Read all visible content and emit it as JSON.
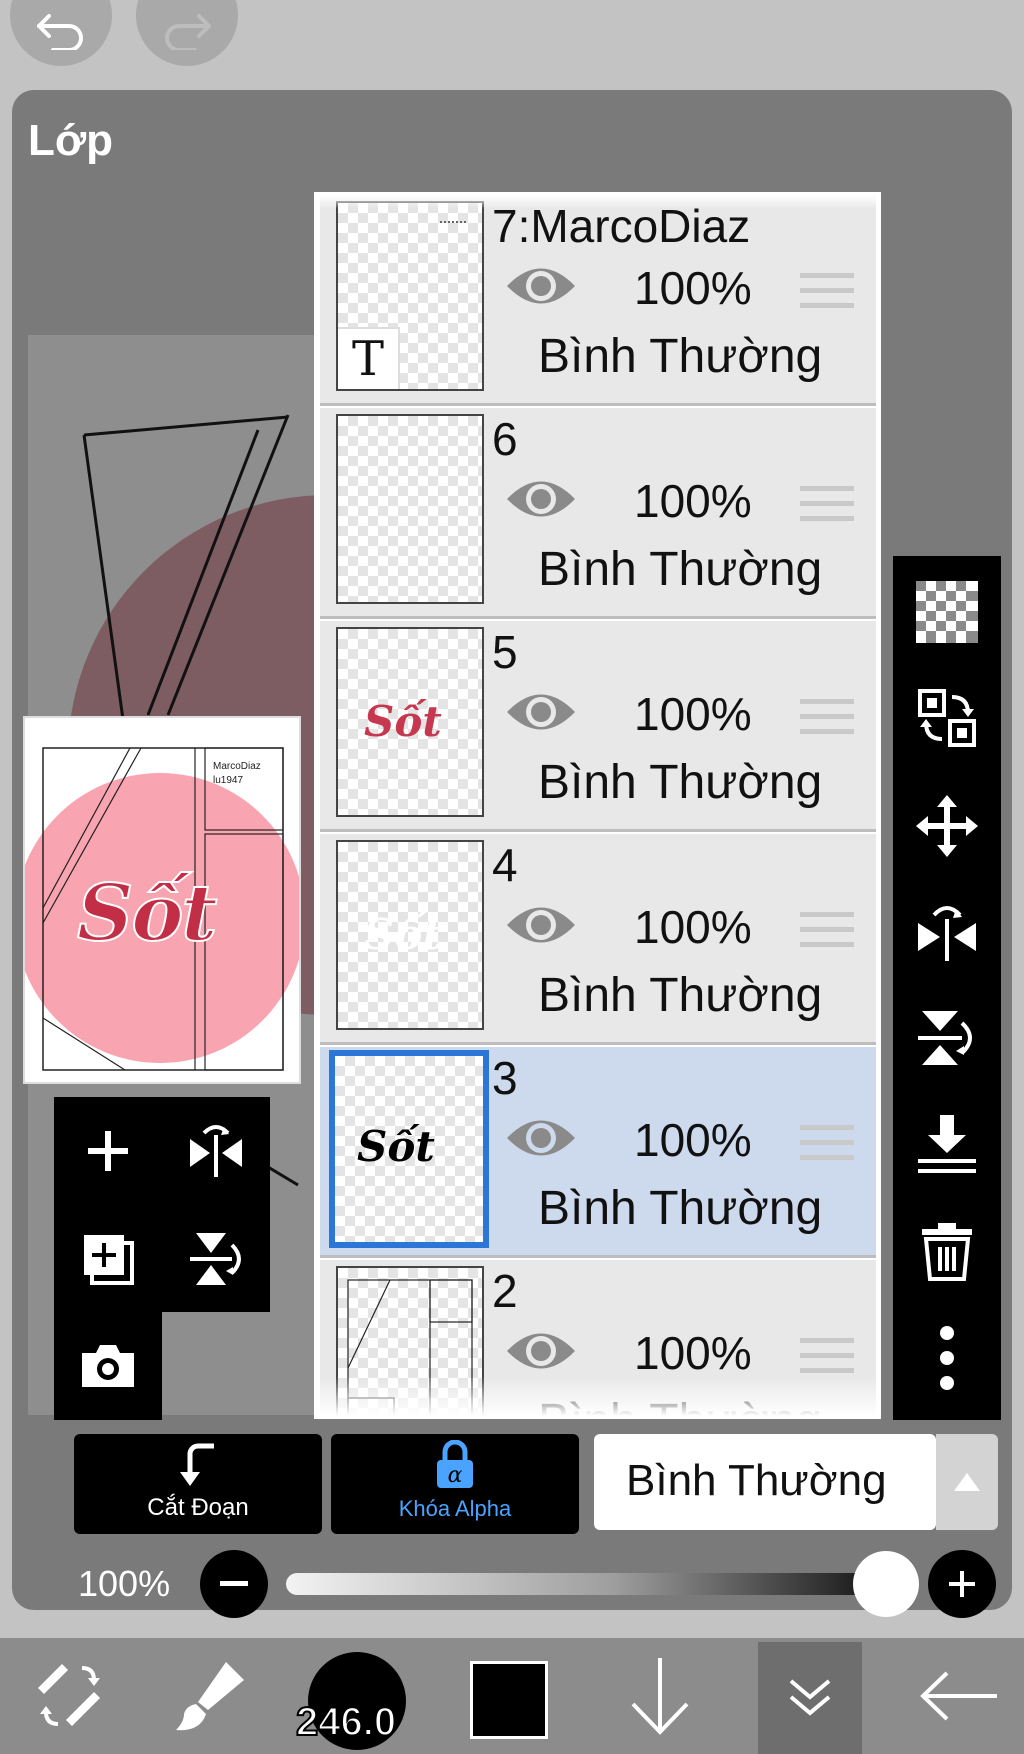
{
  "panel": {
    "title": "Lớp"
  },
  "layers": [
    {
      "name": "7:MarcoDiaz",
      "opacity": "100%",
      "mode": "Bình Thường",
      "type": "text",
      "selected": false
    },
    {
      "name": "6",
      "opacity": "100%",
      "mode": "Bình Thường",
      "type": "empty",
      "selected": false
    },
    {
      "name": "5",
      "opacity": "100%",
      "mode": "Bình Thường",
      "type": "art-red",
      "selected": false
    },
    {
      "name": "4",
      "opacity": "100%",
      "mode": "Bình Thường",
      "type": "art-white",
      "selected": false
    },
    {
      "name": "3",
      "opacity": "100%",
      "mode": "Bình Thường",
      "type": "art-black",
      "selected": true
    },
    {
      "name": "2",
      "opacity": "100%",
      "mode": "Bình Thường",
      "type": "frames",
      "selected": false
    }
  ],
  "thumb_text": {
    "text_layer_glyph": "T",
    "art": "Sốt"
  },
  "preview": {
    "art": "Sốt",
    "caption_line1": "MarcoDiaz",
    "caption_line2": "lu1947"
  },
  "actions": {
    "clip_label": "Cắt Đoạn",
    "alpha_lock_label": "Khóa Alpha",
    "blend_mode": "Bình Thường"
  },
  "opacity": {
    "label": "100%",
    "value": 1.0
  },
  "brush": {
    "size": "246.0"
  },
  "colors": {
    "selected_layer": "#cdd9ec",
    "selection_border": "#2b76d6",
    "alpha_lock": "#4aa3ff",
    "current_color": "#000000"
  },
  "icons": {
    "top": [
      "undo-icon",
      "redo-icon"
    ],
    "left": [
      "add-layer-icon",
      "flip-horizontal-icon",
      "add-copy-layer-icon",
      "flip-vertical-icon",
      "camera-icon"
    ],
    "right": [
      "transparency-icon",
      "layer-transform-icon",
      "move-icon",
      "flip-horizontal-icon",
      "flip-vertical-icon",
      "merge-down-icon",
      "trash-icon",
      "more-icon"
    ],
    "bottom": [
      "tools-icon",
      "brush-icon",
      "brush-size-icon",
      "color-icon",
      "arrow-down-icon",
      "layers-collapse-icon",
      "back-icon"
    ]
  }
}
